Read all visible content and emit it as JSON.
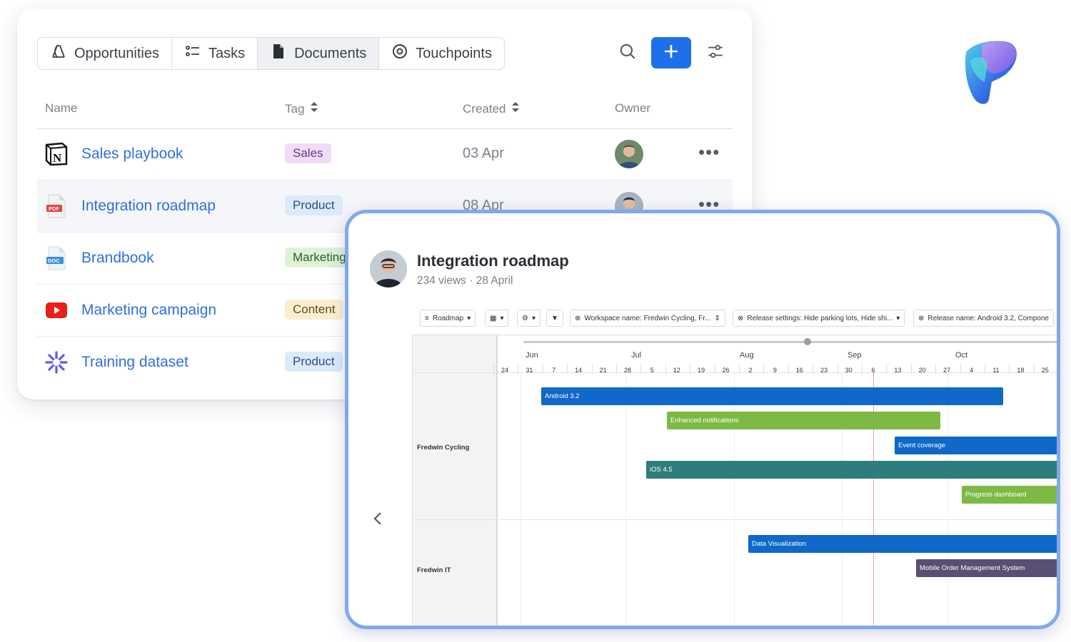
{
  "tabs": [
    {
      "label": "Opportunities",
      "icon": "opportunities-icon",
      "active": false
    },
    {
      "label": "Tasks",
      "icon": "tasks-list-icon",
      "active": false
    },
    {
      "label": "Documents",
      "icon": "document-icon",
      "active": true
    },
    {
      "label": "Touchpoints",
      "icon": "target-icon",
      "active": false
    }
  ],
  "toolbar": {
    "search_icon": "search-icon",
    "add_icon": "plus-icon",
    "filter_icon": "sliders-icon"
  },
  "table": {
    "headers": {
      "name": "Name",
      "tag": "Tag",
      "created": "Created",
      "owner": "Owner"
    },
    "rows": [
      {
        "name": "Sales playbook",
        "icon": "notion-icon",
        "tag": "Sales",
        "tag_bg": "#f0dcf7",
        "tag_color": "#6c3a86",
        "created": "03 Apr"
      },
      {
        "name": "Integration roadmap",
        "icon": "pdf-file-icon",
        "tag": "Product",
        "tag_bg": "#dceafb",
        "tag_color": "#2b4f80",
        "created": "08 Apr"
      },
      {
        "name": "Brandbook",
        "icon": "doc-file-icon",
        "tag": "Marketing",
        "tag_bg": "#dcf3d8",
        "tag_color": "#2f5a2a",
        "created": ""
      },
      {
        "name": "Marketing campaign",
        "icon": "youtube-icon",
        "tag": "Content",
        "tag_bg": "#fcefd0",
        "tag_color": "#6a4a10",
        "created": ""
      },
      {
        "name": "Training dataset",
        "icon": "asterisk-icon",
        "tag": "Product",
        "tag_bg": "#dceafb",
        "tag_color": "#2b4f80",
        "created": ""
      }
    ]
  },
  "panel": {
    "title": "Integration roadmap",
    "meta": "234 views · 28 April",
    "toolbar": [
      {
        "label": "Roadmap",
        "icon": "list-icon"
      },
      {
        "label": "",
        "icon": "calendar-icon"
      },
      {
        "label": "",
        "icon": "gear-icon"
      },
      {
        "label": "",
        "icon": "filter-icon"
      },
      {
        "label": "Workspace name: Fredwin Cycling, Fr...",
        "icon": "close-circle-icon"
      },
      {
        "label": "Release settings: Hide parking lots, Hide shi...",
        "icon": "close-circle-icon"
      },
      {
        "label": "Release name: Android 3.2, Compone",
        "icon": "close-circle-icon"
      }
    ],
    "gantt": {
      "months": [
        "Jun",
        "Jul",
        "Aug",
        "Sep",
        "Oct"
      ],
      "days": [
        "24",
        "31",
        "7",
        "14",
        "21",
        "28",
        "5",
        "12",
        "19",
        "26",
        "2",
        "9",
        "16",
        "23",
        "30",
        "6",
        "13",
        "20",
        "27",
        "4",
        "11",
        "18",
        "25"
      ],
      "groups": [
        "Fredwin Cycling",
        "Fredwin IT"
      ],
      "bars": [
        {
          "label": "Android 3.2",
          "color": "#1068c9",
          "group": "Fredwin Cycling"
        },
        {
          "label": "Enhanced notifications",
          "color": "#7cba45",
          "group": "Fredwin Cycling"
        },
        {
          "label": "Event coverage",
          "color": "#1068c9",
          "group": "Fredwin Cycling"
        },
        {
          "label": "iOS 4.5",
          "color": "#2f7c7c",
          "group": "Fredwin Cycling"
        },
        {
          "label": "Progress dashboard",
          "color": "#7cba45",
          "group": "Fredwin Cycling"
        },
        {
          "label": "Data Visualization",
          "color": "#1068c9",
          "group": "Fredwin IT"
        },
        {
          "label": "Mobile Order Management System",
          "color": "#5a4f73",
          "group": "Fredwin IT"
        }
      ]
    }
  }
}
